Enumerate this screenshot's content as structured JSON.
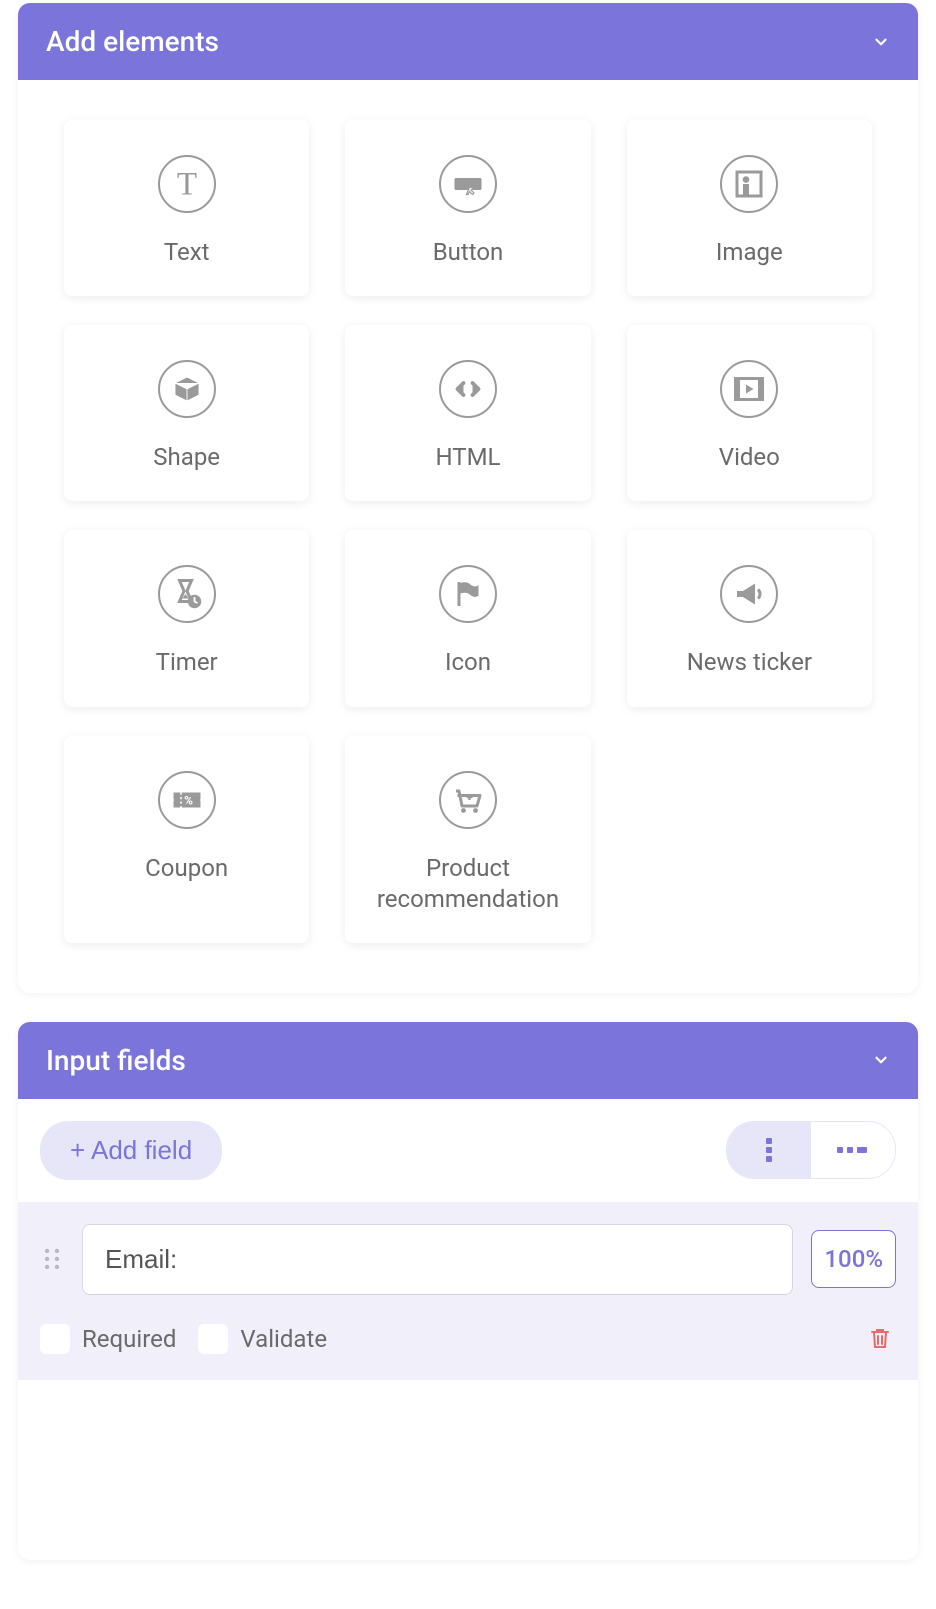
{
  "panels": {
    "add_elements": {
      "title": "Add elements",
      "items": [
        {
          "label": "Text",
          "icon": "text"
        },
        {
          "label": "Button",
          "icon": "button"
        },
        {
          "label": "Image",
          "icon": "image"
        },
        {
          "label": "Shape",
          "icon": "shape"
        },
        {
          "label": "HTML",
          "icon": "html"
        },
        {
          "label": "Video",
          "icon": "video"
        },
        {
          "label": "Timer",
          "icon": "timer"
        },
        {
          "label": "Icon",
          "icon": "icon"
        },
        {
          "label": "News ticker",
          "icon": "news"
        },
        {
          "label": "Coupon",
          "icon": "coupon"
        },
        {
          "label": "Product recommendation",
          "icon": "product"
        }
      ]
    },
    "input_fields": {
      "title": "Input fields",
      "add_field_label": "+ Add field",
      "view_mode": "vertical",
      "fields": [
        {
          "value": "Email:",
          "width_label": "100%",
          "required_label": "Required",
          "required_checked": false,
          "validate_label": "Validate",
          "validate_checked": false
        }
      ]
    }
  }
}
